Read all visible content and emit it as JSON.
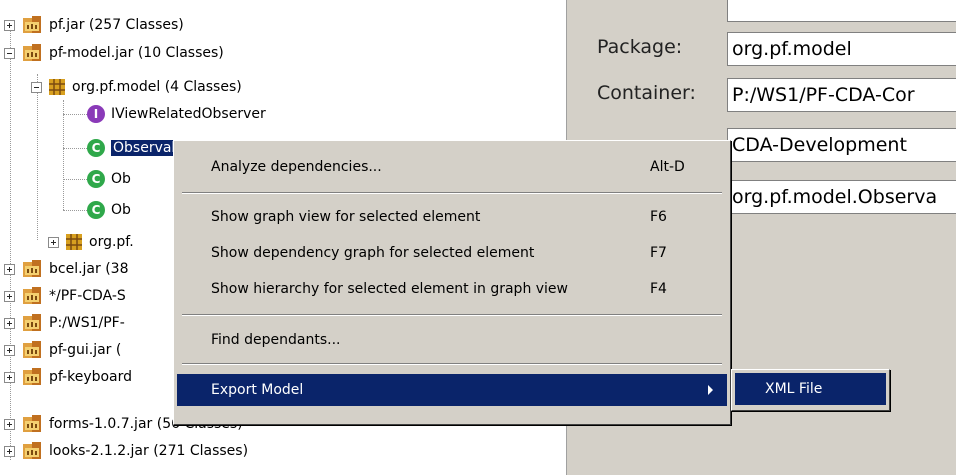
{
  "tree": {
    "items": [
      {
        "label": "pf.jar (257 Classes)"
      },
      {
        "label": "pf-model.jar (10 Classes)"
      },
      {
        "label": "org.pf.model (4 Classes)"
      },
      {
        "label": "IViewRelatedObserver"
      },
      {
        "label": "ObservableModel"
      },
      {
        "label": "Ob"
      },
      {
        "label": "Ob"
      },
      {
        "label": "org.pf."
      },
      {
        "label": "bcel.jar (38"
      },
      {
        "label": "*/PF-CDA-S"
      },
      {
        "label": "P:/WS1/PF-"
      },
      {
        "label": "pf-gui.jar ("
      },
      {
        "label": "pf-keyboard"
      },
      {
        "label": "forms-1.0.7.jar (56 Classes)"
      },
      {
        "label": "looks-2.1.2.jar (271 Classes)"
      }
    ]
  },
  "properties": {
    "package_label": "Package:",
    "package_value": "org.pf.model",
    "container_label": "Container:",
    "container_value": "P:/WS1/PF-CDA-Cor",
    "workset_value": "CDA-Development",
    "name_value": "org.pf.model.Observa"
  },
  "context_menu": {
    "items": [
      {
        "label": "Analyze dependencies...",
        "shortcut": "Alt-D"
      },
      {
        "label": "Show graph view for selected element",
        "shortcut": "F6"
      },
      {
        "label": "Show dependency graph for selected element",
        "shortcut": "F7"
      },
      {
        "label": "Show hierarchy for selected element in graph view",
        "shortcut": "F4"
      },
      {
        "label": "Find dependants..."
      },
      {
        "label": "Export Model"
      }
    ]
  },
  "submenu": {
    "items": [
      {
        "label": "XML File"
      }
    ]
  },
  "icons": {
    "jar": "jar-icon",
    "package": "package-icon",
    "class": "class-icon",
    "interface": "interface-icon",
    "submenu_arrow": "submenu-arrow-icon"
  },
  "colors": {
    "selection": "#0a246a",
    "class_icon": "#2fa84a",
    "interface_icon": "#8a3ab8",
    "package_icon": "#d8a020",
    "panel_bg": "#d4d0c8"
  }
}
